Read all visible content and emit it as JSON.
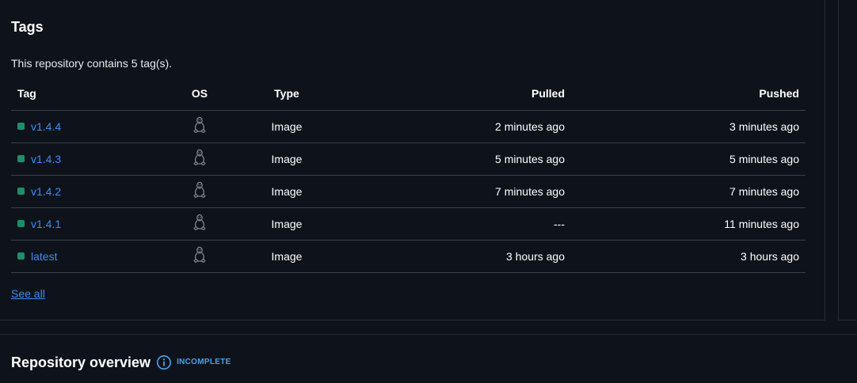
{
  "tags_section": {
    "title": "Tags",
    "summary": "This repository contains 5 tag(s).",
    "columns": {
      "tag": "Tag",
      "os": "OS",
      "type": "Type",
      "pulled": "Pulled",
      "pushed": "Pushed"
    },
    "rows": [
      {
        "tag": "v1.4.4",
        "os_icon": "linux-icon",
        "type": "Image",
        "pulled": "2 minutes ago",
        "pushed": "3 minutes ago"
      },
      {
        "tag": "v1.4.3",
        "os_icon": "linux-icon",
        "type": "Image",
        "pulled": "5 minutes ago",
        "pushed": "5 minutes ago"
      },
      {
        "tag": "v1.4.2",
        "os_icon": "linux-icon",
        "type": "Image",
        "pulled": "7 minutes ago",
        "pushed": "7 minutes ago"
      },
      {
        "tag": "v1.4.1",
        "os_icon": "linux-icon",
        "type": "Image",
        "pulled": "---",
        "pushed": "11 minutes ago"
      },
      {
        "tag": "latest",
        "os_icon": "linux-icon",
        "type": "Image",
        "pulled": "3 hours ago",
        "pushed": "3 hours ago"
      }
    ],
    "see_all": "See all"
  },
  "overview_section": {
    "title": "Repository overview",
    "info_icon": "info-icon",
    "badge": "INCOMPLETE"
  },
  "colors": {
    "background": "#0e131b",
    "link": "#3f8cf2",
    "status_dot": "#1b8f6a",
    "badge": "#4aa3e8",
    "row_border": "#3a414c"
  }
}
